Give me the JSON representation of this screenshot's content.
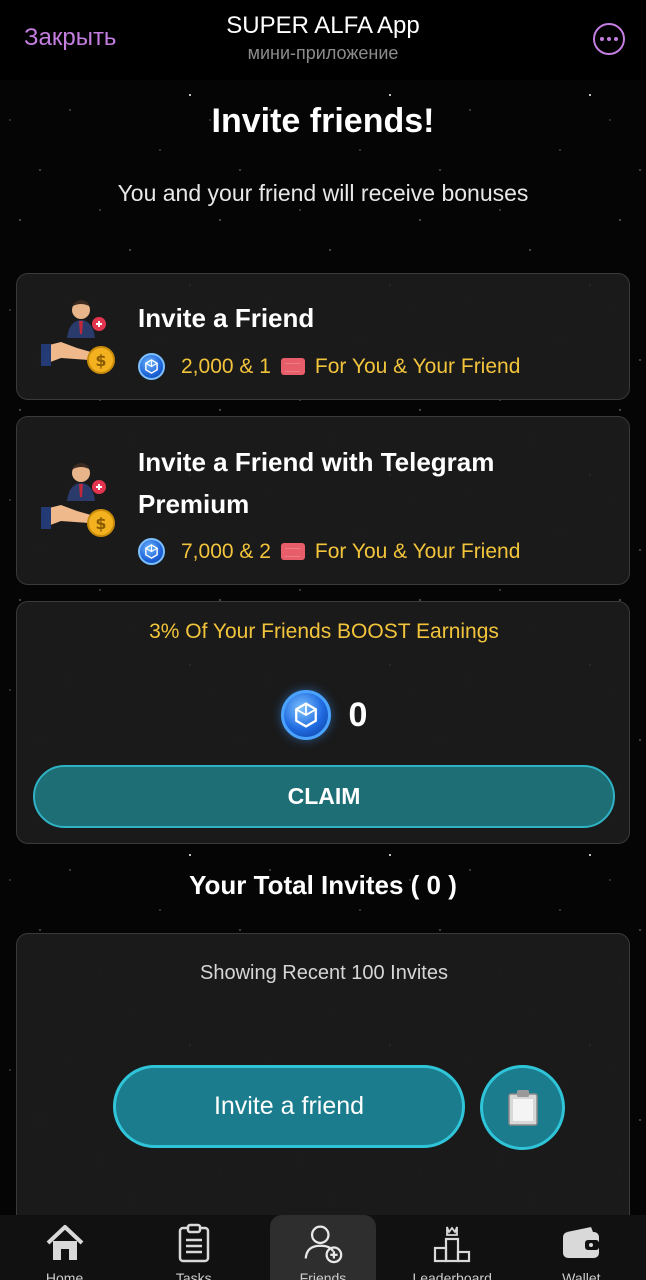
{
  "header": {
    "close_label": "Закрыть",
    "title": "SUPER ALFA App",
    "subtitle": "мини-приложение"
  },
  "page": {
    "title": "Invite friends!",
    "subtitle": "You and your friend will receive bonuses"
  },
  "invite_card": {
    "title": "Invite a Friend",
    "coin_amount": "2,000 & 1",
    "ticket_text": "For You & Your Friend"
  },
  "premium_card": {
    "title": "Invite a Friend with Telegram Premium",
    "coin_amount": "7,000 & 2",
    "ticket_text": "For You & Your Friend"
  },
  "boost_card": {
    "label": "3% Of Your Friends BOOST Earnings",
    "amount": "0",
    "claim_label": "CLAIM"
  },
  "invites": {
    "total_label": "Your Total Invites ( 0 )",
    "list_label": "Showing Recent 100 Invites",
    "invite_button_label": "Invite a friend"
  },
  "bottom_nav": {
    "items": [
      {
        "label": "Home",
        "icon": "home-icon"
      },
      {
        "label": "Tasks",
        "icon": "clipboard-icon"
      },
      {
        "label": "Friends",
        "icon": "add-user-icon",
        "active": true
      },
      {
        "label": "Leaderboard",
        "icon": "podium-icon"
      },
      {
        "label": "Wallet",
        "icon": "wallet-icon"
      }
    ]
  },
  "colors": {
    "accent_purple": "#c47ee0",
    "gold_text": "#f2c43c",
    "teal_button": "#1a7c8d",
    "teal_border": "#2fc4d8",
    "coin_blue": "#1f6ae0"
  }
}
